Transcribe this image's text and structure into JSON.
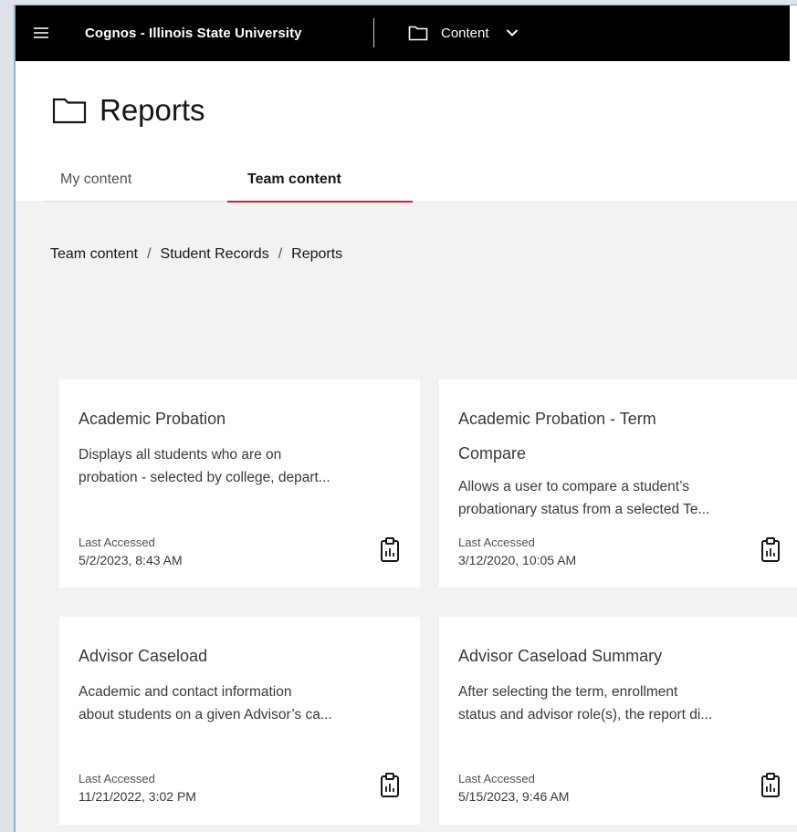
{
  "topbar": {
    "app_title": "Cognos - Illinois State University",
    "switcher_label": "Content",
    "icons": [
      "hamburger-menu-icon",
      "folder-icon",
      "chevron-down-icon"
    ]
  },
  "page": {
    "title": "Reports",
    "title_icon": "folder-icon"
  },
  "tabs": [
    {
      "label": "My content",
      "active": false
    },
    {
      "label": "Team content",
      "active": true
    }
  ],
  "breadcrumb": [
    "Team content",
    "Student Records",
    "Reports"
  ],
  "breadcrumb_separator": "/",
  "cards": [
    {
      "title": "Academic Probation",
      "description_line1": "Displays all students who are on",
      "description_line2": "probation - selected by college, depart...",
      "last_accessed_label": "Last Accessed",
      "last_accessed": "5/2/2023, 8:43 AM",
      "icon": "report-icon"
    },
    {
      "title_line1": "Academic Probation - Term",
      "title_line2": "Compare",
      "description_line1": "Allows a user to compare a student’s",
      "description_line2": "probationary status from a selected Te...",
      "last_accessed_label": "Last Accessed",
      "last_accessed": "3/12/2020, 10:05 AM",
      "icon": "report-icon"
    },
    {
      "title": "Advisor Caseload",
      "description_line1": "Academic and contact information",
      "description_line2": "about students on a given Advisor’s ca...",
      "last_accessed_label": "Last Accessed",
      "last_accessed": "11/21/2022, 3:02 PM",
      "icon": "report-icon"
    },
    {
      "title": "Advisor Caseload Summary",
      "description_line1": "After selecting the term, enrollment",
      "description_line2": "status and advisor role(s), the report di...",
      "last_accessed_label": "Last Accessed",
      "last_accessed": "5/15/2023, 9:46 AM",
      "icon": "report-icon"
    }
  ],
  "colors": {
    "topbar_bg": "#000000",
    "active_tab_underline": "#da1e28",
    "page_bg": "#f2f2f2",
    "card_bg": "#ffffff"
  }
}
